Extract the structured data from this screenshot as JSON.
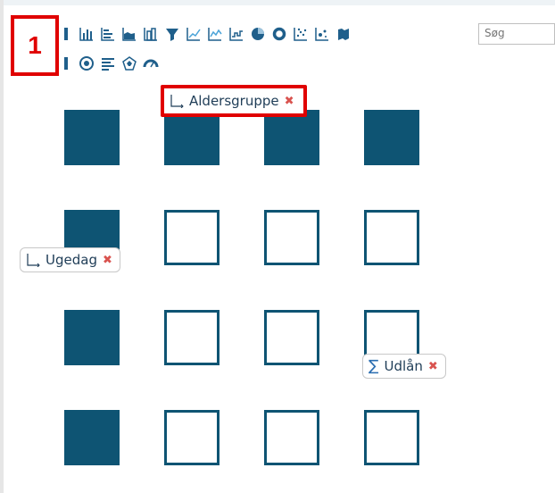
{
  "callout": {
    "label": "1"
  },
  "toolbar": {
    "icons": [
      "grid-chart-icon",
      "bar-chart-icon",
      "horizontal-bar-icon",
      "area-chart-icon",
      "column-chart-icon",
      "funnel-icon",
      "line-chart-icon",
      "combo-line-icon",
      "step-chart-icon",
      "pie-chart-icon",
      "donut-chart-icon",
      "scatter-chart-icon",
      "bubble-chart-icon",
      "map-icon",
      "table-icon",
      "target-icon",
      "text-list-icon",
      "radar-icon",
      "gauge-icon"
    ],
    "search_placeholder": "Søg"
  },
  "chips": {
    "column": {
      "label": "Aldersgruppe",
      "remove": "✖"
    },
    "row": {
      "label": "Ugedag",
      "remove": "✖"
    },
    "measure": {
      "label": "Udlån",
      "remove": "✖"
    }
  },
  "colors": {
    "accent": "#0e5473",
    "highlight": "#e00000",
    "remove": "#d9534f"
  },
  "grid": {
    "rows": [
      [
        "filled",
        "filled",
        "filled",
        "filled"
      ],
      [
        "filled",
        "empty",
        "empty",
        "empty"
      ],
      [
        "filled",
        "empty",
        "empty",
        "empty"
      ],
      [
        "filled",
        "empty",
        "empty",
        "empty"
      ]
    ]
  }
}
